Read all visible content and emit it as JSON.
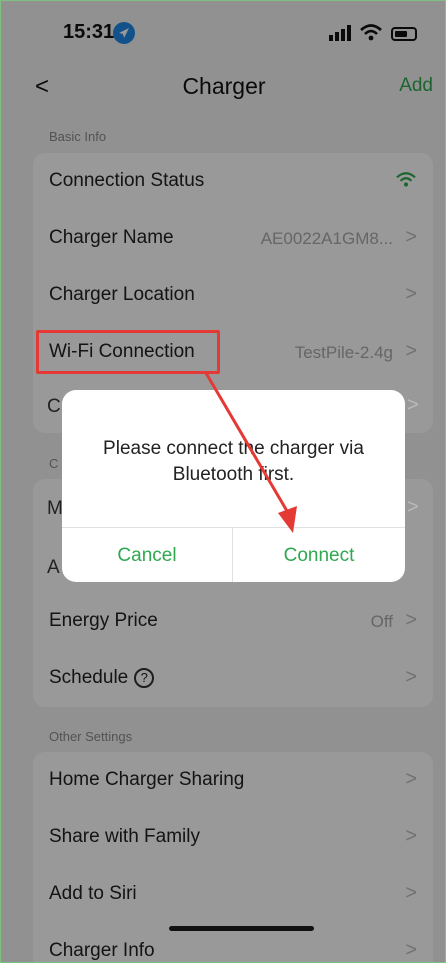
{
  "status_bar": {
    "time": "15:31"
  },
  "nav": {
    "back": "<",
    "title": "Charger",
    "add": "Add"
  },
  "basic_info": {
    "label": "Basic Info",
    "rows": [
      {
        "label": "Connection Status",
        "value": ""
      },
      {
        "label": "Charger Name",
        "value": "AE0022A1GM8..."
      },
      {
        "label": "Charger Location",
        "value": ""
      },
      {
        "label": "Wi-Fi Connection",
        "value": "TestPile-2.4g"
      }
    ],
    "peek_row_initial": "C"
  },
  "charging_settings": {
    "label_initial": "C",
    "peek_rows": [
      "M",
      "A"
    ],
    "rows": [
      {
        "label": "Energy Price",
        "value": "Off"
      },
      {
        "label": "Schedule",
        "help": "?"
      }
    ]
  },
  "other_settings": {
    "label": "Other Settings",
    "rows": [
      {
        "label": "Home Charger Sharing"
      },
      {
        "label": "Share with Family"
      },
      {
        "label": "Add to Siri"
      },
      {
        "label": "Charger Info"
      }
    ]
  },
  "chevron": ">",
  "dialog": {
    "message": "Please connect the charger via Bluetooth first.",
    "cancel": "Cancel",
    "connect": "Connect"
  },
  "colors": {
    "accent": "#2fa84f",
    "annotation": "#e53935"
  },
  "icons": {
    "status": [
      "location-arrow-icon",
      "cellular-signal-icon",
      "wifi-icon",
      "battery-icon"
    ],
    "connection_status": "wifi-icon"
  }
}
